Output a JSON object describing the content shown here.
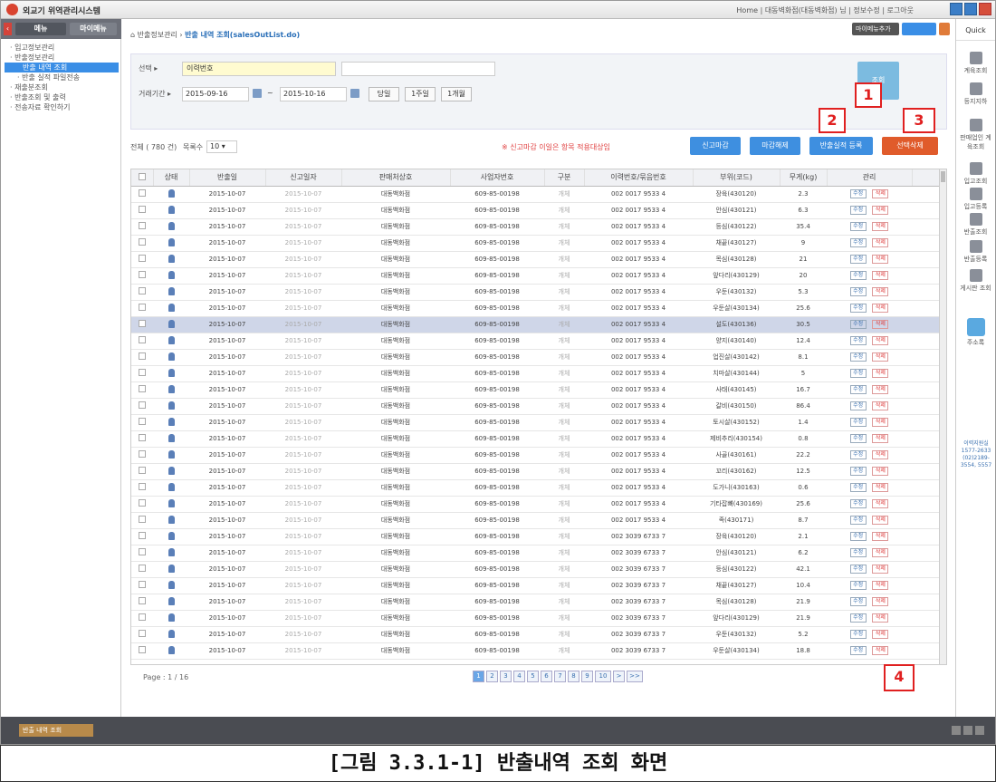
{
  "app_title": "외교기 위역관리시스템",
  "top_user_info": "Home | 대동벽화점(대동벽화점) 님 | 정보수정 | 로그아웃",
  "left_nav": {
    "tab1": "메뉴",
    "tab2": "마이메뉴",
    "items": [
      {
        "label": "· 입고정보관리",
        "level": 0,
        "active": false
      },
      {
        "label": "· 반출정보관리",
        "level": 0,
        "active": false
      },
      {
        "label": "반출 내역 조회",
        "level": 1,
        "active": true
      },
      {
        "label": "· 반출 실적 파일전송",
        "level": 1,
        "active": false
      },
      {
        "label": "· 재출분조회",
        "level": 0,
        "active": false
      },
      {
        "label": "· 반출조회 및 출력",
        "level": 0,
        "active": false
      },
      {
        "label": "· 전송자료 확인하기",
        "level": 0,
        "active": false
      }
    ]
  },
  "breadcrumb": {
    "prefix": "반출정보관리 ›",
    "current": "반출 내역 조회(salesOutList.do)"
  },
  "top_icons": {
    "a": "마이메뉴추가",
    "b": "",
    "c": ""
  },
  "search": {
    "select_label": "선택 ▸",
    "select_value": "이력번호",
    "period_label": "거래기간 ▸",
    "date_from": "2015-09-16",
    "date_to": "2015-10-16",
    "tilde": "~",
    "period_buttons": [
      "당일",
      "1주일",
      "1개월"
    ],
    "search_button": "조회"
  },
  "actions": {
    "count": "전체 ( 780 건)",
    "rows_label": "목록수",
    "rows_value": "10 ▾",
    "notice": "※ 신고마감 이일은 항목 적용대상임",
    "btn_report": "신고마감",
    "btn_cancel": "마감해제",
    "btn_register": "반출실적 등록",
    "btn_delete": "선택삭제"
  },
  "annotations": [
    "1",
    "2",
    "3",
    "4"
  ],
  "table": {
    "headers": [
      "",
      "상태",
      "반출일",
      "신고일자",
      "판매처상호",
      "사업자번호",
      "구분",
      "이력번호/묶음번호",
      "부위(코드)",
      "무게(kg)",
      "관리",
      ""
    ],
    "edit_label": "수정",
    "delete_label": "삭제",
    "rows": [
      [
        "2015-10-07",
        "2015-10-07",
        "대동백화점",
        "609-85-00198",
        "개체",
        "002 0017 9533 4",
        "장육(430120)",
        "2.3"
      ],
      [
        "2015-10-07",
        "2015-10-07",
        "대동백화점",
        "609-85-00198",
        "개체",
        "002 0017 9533 4",
        "안심(430121)",
        "6.3"
      ],
      [
        "2015-10-07",
        "2015-10-07",
        "대동백화점",
        "609-85-00198",
        "개체",
        "002 0017 9533 4",
        "등심(430122)",
        "35.4"
      ],
      [
        "2015-10-07",
        "2015-10-07",
        "대동백화점",
        "609-85-00198",
        "개체",
        "002 0017 9533 4",
        "채끝(430127)",
        "9"
      ],
      [
        "2015-10-07",
        "2015-10-07",
        "대동백화점",
        "609-85-00198",
        "개체",
        "002 0017 9533 4",
        "목심(430128)",
        "21"
      ],
      [
        "2015-10-07",
        "2015-10-07",
        "대동백화점",
        "609-85-00198",
        "개체",
        "002 0017 9533 4",
        "앞다리(430129)",
        "20"
      ],
      [
        "2015-10-07",
        "2015-10-07",
        "대동백화점",
        "609-85-00198",
        "개체",
        "002 0017 9533 4",
        "우둔(430132)",
        "5.3"
      ],
      [
        "2015-10-07",
        "2015-10-07",
        "대동백화점",
        "609-85-00198",
        "개체",
        "002 0017 9533 4",
        "우둔살(430134)",
        "25.6"
      ],
      [
        "2015-10-07",
        "2015-10-07",
        "대동백화점",
        "609-85-00198",
        "개체",
        "002 0017 9533 4",
        "설도(430136)",
        "30.5"
      ],
      [
        "2015-10-07",
        "2015-10-07",
        "대동백화점",
        "609-85-00198",
        "개체",
        "002 0017 9533 4",
        "양지(430140)",
        "12.4"
      ],
      [
        "2015-10-07",
        "2015-10-07",
        "대동백화점",
        "609-85-00198",
        "개체",
        "002 0017 9533 4",
        "업진살(430142)",
        "8.1"
      ],
      [
        "2015-10-07",
        "2015-10-07",
        "대동백화점",
        "609-85-00198",
        "개체",
        "002 0017 9533 4",
        "치마살(430144)",
        "5"
      ],
      [
        "2015-10-07",
        "2015-10-07",
        "대동백화점",
        "609-85-00198",
        "개체",
        "002 0017 9533 4",
        "사태(430145)",
        "16.7"
      ],
      [
        "2015-10-07",
        "2015-10-07",
        "대동백화점",
        "609-85-00198",
        "개체",
        "002 0017 9533 4",
        "갈비(430150)",
        "86.4"
      ],
      [
        "2015-10-07",
        "2015-10-07",
        "대동백화점",
        "609-85-00198",
        "개체",
        "002 0017 9533 4",
        "토시살(430152)",
        "1.4"
      ],
      [
        "2015-10-07",
        "2015-10-07",
        "대동백화점",
        "609-85-00198",
        "개체",
        "002 0017 9533 4",
        "제비추리(430154)",
        "0.8"
      ],
      [
        "2015-10-07",
        "2015-10-07",
        "대동백화점",
        "609-85-00198",
        "개체",
        "002 0017 9533 4",
        "사골(430161)",
        "22.2"
      ],
      [
        "2015-10-07",
        "2015-10-07",
        "대동백화점",
        "609-85-00198",
        "개체",
        "002 0017 9533 4",
        "꼬리(430162)",
        "12.5"
      ],
      [
        "2015-10-07",
        "2015-10-07",
        "대동백화점",
        "609-85-00198",
        "개체",
        "002 0017 9533 4",
        "도가니(430163)",
        "0.6"
      ],
      [
        "2015-10-07",
        "2015-10-07",
        "대동백화점",
        "609-85-00198",
        "개체",
        "002 0017 9533 4",
        "기타잡뼈(430169)",
        "25.6"
      ],
      [
        "2015-10-07",
        "2015-10-07",
        "대동백화점",
        "609-85-00198",
        "개체",
        "002 0017 9533 4",
        "족(430171)",
        "8.7"
      ],
      [
        "2015-10-07",
        "2015-10-07",
        "대동백화점",
        "609-85-00198",
        "개체",
        "002 3039 6733 7",
        "장육(430120)",
        "2.1"
      ],
      [
        "2015-10-07",
        "2015-10-07",
        "대동백화점",
        "609-85-00198",
        "개체",
        "002 3039 6733 7",
        "안심(430121)",
        "6.2"
      ],
      [
        "2015-10-07",
        "2015-10-07",
        "대동백화점",
        "609-85-00198",
        "개체",
        "002 3039 6733 7",
        "등심(430122)",
        "42.1"
      ],
      [
        "2015-10-07",
        "2015-10-07",
        "대동백화점",
        "609-85-00198",
        "개체",
        "002 3039 6733 7",
        "채끝(430127)",
        "10.4"
      ],
      [
        "2015-10-07",
        "2015-10-07",
        "대동백화점",
        "609-85-00198",
        "개체",
        "002 3039 6733 7",
        "목심(430128)",
        "21.9"
      ],
      [
        "2015-10-07",
        "2015-10-07",
        "대동백화점",
        "609-85-00198",
        "개체",
        "002 3039 6733 7",
        "앞다리(430129)",
        "21.9"
      ],
      [
        "2015-10-07",
        "2015-10-07",
        "대동백화점",
        "609-85-00198",
        "개체",
        "002 3039 6733 7",
        "우둔(430132)",
        "5.2"
      ],
      [
        "2015-10-07",
        "2015-10-07",
        "대동백화점",
        "609-85-00198",
        "개체",
        "002 3039 6733 7",
        "우둔살(430134)",
        "18.8"
      ]
    ]
  },
  "pager": {
    "info": "Page : 1 / 16",
    "pages": [
      "1",
      "2",
      "3",
      "4",
      "5",
      "6",
      "7",
      "8",
      "9",
      "10"
    ],
    "next": ">",
    "last": ">>"
  },
  "quick": {
    "title": "Quick",
    "items": [
      "계육조회",
      "등지지하",
      "판매업인 계육조회",
      "입고조회",
      "입고등록",
      "반출조회",
      "반출등록",
      "게시판 조회",
      "주소록"
    ],
    "call_center": "이력지원실 1577-2633 (02)2189-3554, 5557"
  },
  "bottom_task": "반출 내역 조회",
  "caption": "[그림 3.3.1-1] 반출내역 조회 화면"
}
